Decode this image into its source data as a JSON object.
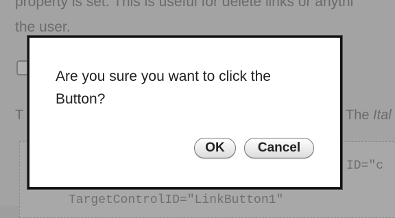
{
  "background_page": {
    "line_top": "property is set. This is useful for delete links or anythi",
    "line_second": "the user.",
    "text_left": "T",
    "text_right_prefix": "The ",
    "text_right_italic": "Ital",
    "code_right": "ID=\"c",
    "code_bottom": "TargetControlID=\"LinkButton1\""
  },
  "dialog": {
    "message": "Are you sure you want to click the Button?",
    "ok_label": "OK",
    "cancel_label": "Cancel"
  }
}
